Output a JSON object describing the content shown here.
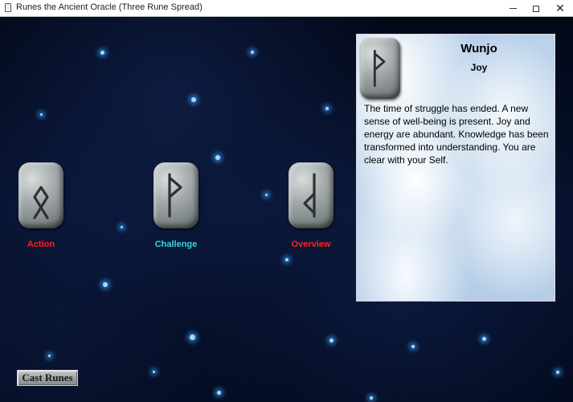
{
  "window": {
    "title": "Runes the Ancient Oracle (Three Rune Spread)"
  },
  "spread": [
    {
      "position_label": "Action",
      "label_color": "#ff2020",
      "rune_glyph": "othala"
    },
    {
      "position_label": "Challenge",
      "label_color": "#33d6e6",
      "rune_glyph": "wunjo"
    },
    {
      "position_label": "Overview",
      "label_color": "#ff2020",
      "rune_glyph": "reversed-rune"
    }
  ],
  "detail": {
    "rune_name": "Wunjo",
    "meaning": "Joy",
    "rune_glyph": "wunjo",
    "description": "The time of struggle has ended.  A new sense of well-being is present.  Joy and energy are abundant. Knowledge has been transformed into understanding. You are clear with your Self."
  },
  "controls": {
    "cast_label": "Cast Runes"
  },
  "colors": {
    "background": "#030818",
    "star": "#9fdcff",
    "stone": "#a4aaab",
    "rune_stroke": "#2c3133"
  }
}
